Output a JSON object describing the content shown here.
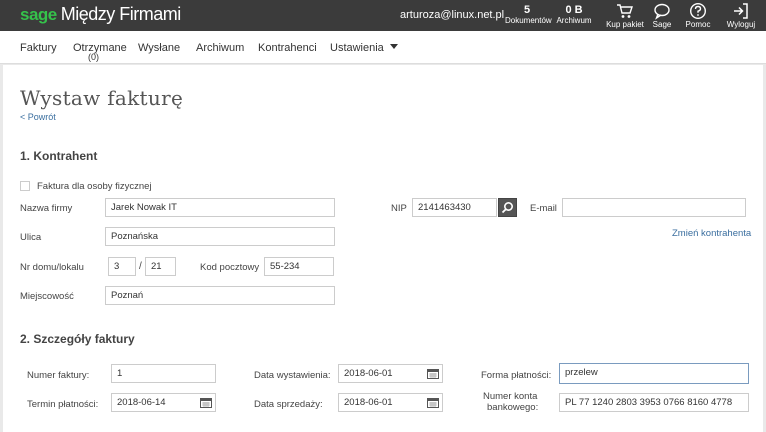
{
  "topbar": {
    "logo_brand": "sage",
    "logo_product": "Między Firmami",
    "user_email": "arturoza@linux.net.pl",
    "documents_count": "5",
    "documents_label": "Dokumentów",
    "archive_size": "0 B",
    "archive_label": "Archiwum",
    "buy_package_label": "Kup pakiet",
    "sage_label": "Sage",
    "help_label": "Pomoc",
    "logout_label": "Wyloguj"
  },
  "nav": {
    "items": [
      {
        "label": "Faktury"
      },
      {
        "label": "Otrzymane"
      },
      {
        "label": "Wysłane"
      },
      {
        "label": "Archiwum"
      },
      {
        "label": "Kontrahenci"
      },
      {
        "label": "Ustawienia"
      }
    ],
    "received_badge": "(0)"
  },
  "page": {
    "title": "Wystaw fakturę",
    "back_link": "< Powrót"
  },
  "contractor": {
    "section_title": "1. Kontrahent",
    "private_person_label": "Faktura dla osoby fizycznej",
    "private_person_checked": false,
    "company_name_label": "Nazwa firmy",
    "company_name_value": "Jarek Nowak IT",
    "street_label": "Ulica",
    "street_value": "Poznańska",
    "house_label": "Nr domu/lokalu",
    "house_number": "3",
    "house_separator": "/",
    "apartment_number": "21",
    "postal_code_label": "Kod pocztowy",
    "postal_code_value": "55-234",
    "city_label": "Miejscowość",
    "city_value": "Poznań",
    "nip_label": "NIP",
    "nip_value": "2141463430",
    "email_label": "E-mail",
    "email_value": "",
    "change_contractor_link": "Zmień kontrahenta"
  },
  "invoice_details": {
    "section_title": "2. Szczegóły faktury",
    "invoice_number_label": "Numer faktury:",
    "invoice_number_value": "1",
    "payment_term_label": "Termin płatności:",
    "payment_term_value": "2018-06-14",
    "issue_date_label": "Data wystawienia:",
    "issue_date_value": "2018-06-01",
    "sale_date_label": "Data sprzedaży:",
    "sale_date_value": "2018-06-01",
    "payment_form_label": "Forma płatności:",
    "payment_form_value": "przelew",
    "bank_account_label_line1": "Numer konta",
    "bank_account_label_line2": "bankowego:",
    "bank_account_value": "PL 77 1240 2803 3953 0766 8160 4778"
  },
  "colors": {
    "topbar_bg": "#3b3b3b",
    "brand_green": "#35c24b",
    "link_blue": "#3a6e9f"
  },
  "icons": [
    "cart-icon",
    "chat-bubble-icon",
    "help-icon",
    "logout-icon",
    "search-icon",
    "calendar-icon",
    "caret-down-icon"
  ]
}
